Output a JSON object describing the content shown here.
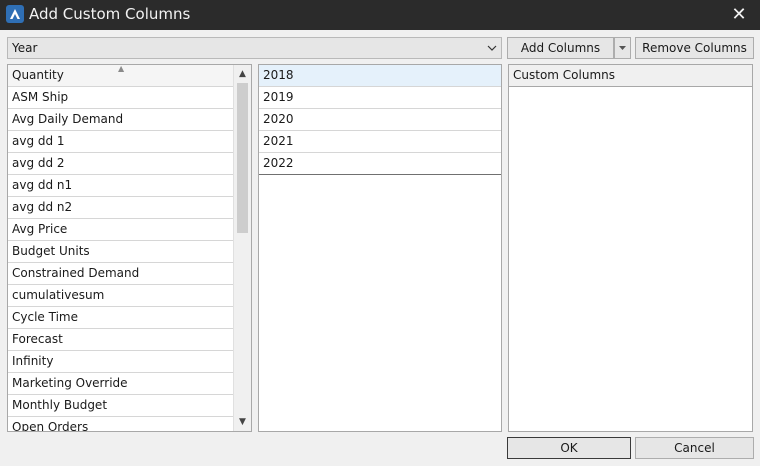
{
  "window": {
    "title": "Add Custom Columns",
    "close_glyph": "✕"
  },
  "toolbar": {
    "combo_value": "Year",
    "add_columns_label": "Add Columns",
    "remove_columns_label": "Remove Columns"
  },
  "measures_list": {
    "header": "Quantity",
    "items": [
      "ASM Ship",
      "Avg Daily Demand",
      "avg dd 1",
      "avg dd 2",
      "avg dd n1",
      "avg dd n2",
      "Avg Price",
      "Budget Units",
      "Constrained Demand",
      "cumulativesum",
      "Cycle Time",
      "Forecast",
      "Infinity",
      "Marketing Override",
      "Monthly Budget",
      "Open Orders"
    ]
  },
  "years_list": {
    "items": [
      "2018",
      "2019",
      "2020",
      "2021",
      "2022"
    ],
    "selected": "2018"
  },
  "custom_columns": {
    "header": "Custom Columns"
  },
  "footer": {
    "ok_label": "OK",
    "cancel_label": "Cancel"
  },
  "icons": {
    "app": "app-logo-icon",
    "close": "close-icon",
    "combo": "chevron-down-icon",
    "scroll_up": "scroll-up-arrow-icon",
    "scroll_down": "scroll-down-arrow-icon"
  },
  "colors": {
    "titlebar": "#2b2b2b",
    "accent": "#2f6fb5",
    "selection": "#e5f1fb"
  }
}
